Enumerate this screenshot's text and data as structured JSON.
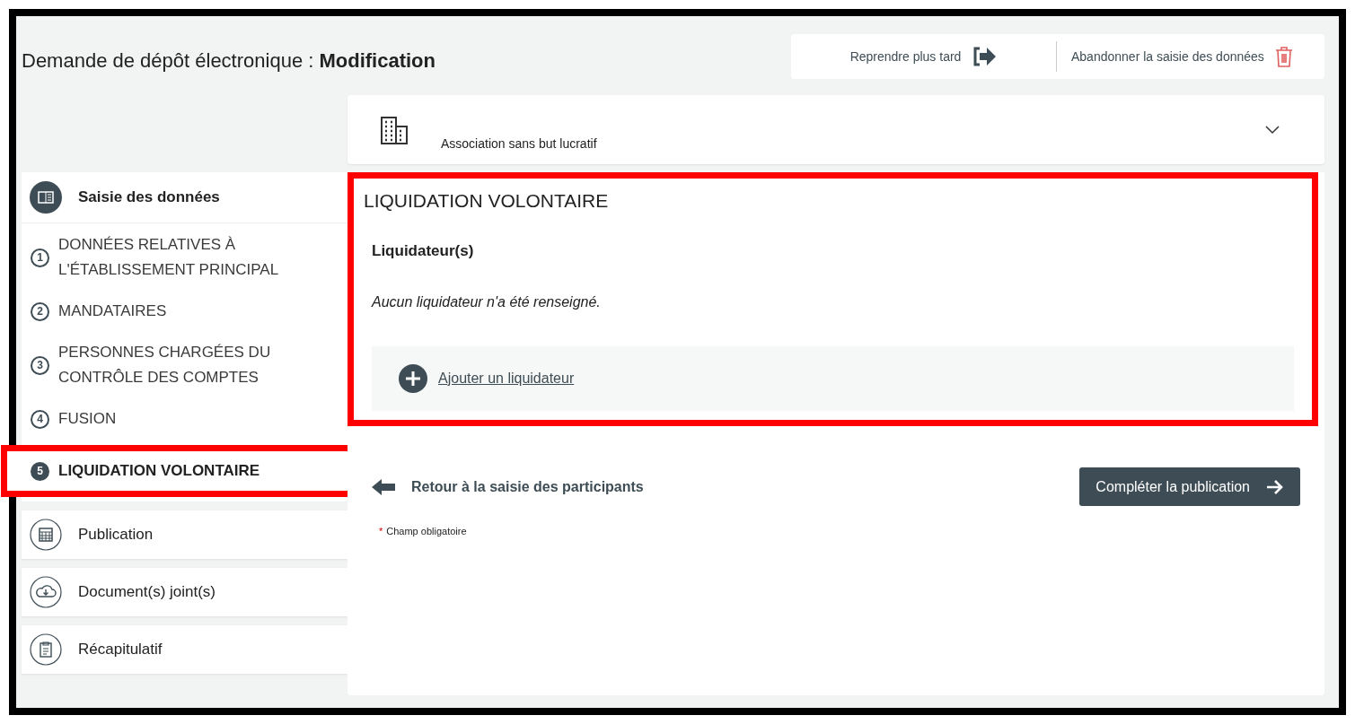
{
  "header": {
    "title": "Demande de dépôt électronique : ",
    "title_bold": "Modification"
  },
  "actions": [
    {
      "label": "Reprendre plus tard",
      "kind": "later"
    },
    {
      "label": "Abandonner la saisie des données",
      "kind": "delete"
    }
  ],
  "organisation": {
    "type": "Association sans but lucratif",
    "expanded": false
  },
  "sidebar": {
    "section": "Saisie des données",
    "steps": [
      {
        "number": "1",
        "label": "DONNÉES RELATIVES À L'ÉTABLISSEMENT PRINCIPAL",
        "selected": false
      },
      {
        "number": "2",
        "label": "MANDATAIRES",
        "selected": false
      },
      {
        "number": "3",
        "label": "PERSONNES CHARGÉES DU CONTRÔLE DES COMPTES",
        "selected": false
      },
      {
        "number": "4",
        "label": "FUSION",
        "selected": false
      },
      {
        "number": "5",
        "label": "LIQUIDATION VOLONTAIRE",
        "selected": true
      }
    ],
    "sections": [
      {
        "label": "Publication",
        "kind": "calendar"
      },
      {
        "label": "Document(s) joint(s)",
        "kind": "cloud"
      },
      {
        "label": "Récapitulatif",
        "kind": "clipboard"
      }
    ]
  },
  "main": {
    "title": "LIQUIDATION VOLONTAIRE",
    "subtitle": "Liquidateur(s)",
    "empty_text": "Aucun liquidateur n'a été renseigné.",
    "add_link": "Ajouter un liquidateur",
    "back_link": "Retour à la saisie des participants",
    "next_button": "Compléter la publication",
    "required_mark": "*",
    "required_note": "Champ obligatoire"
  }
}
